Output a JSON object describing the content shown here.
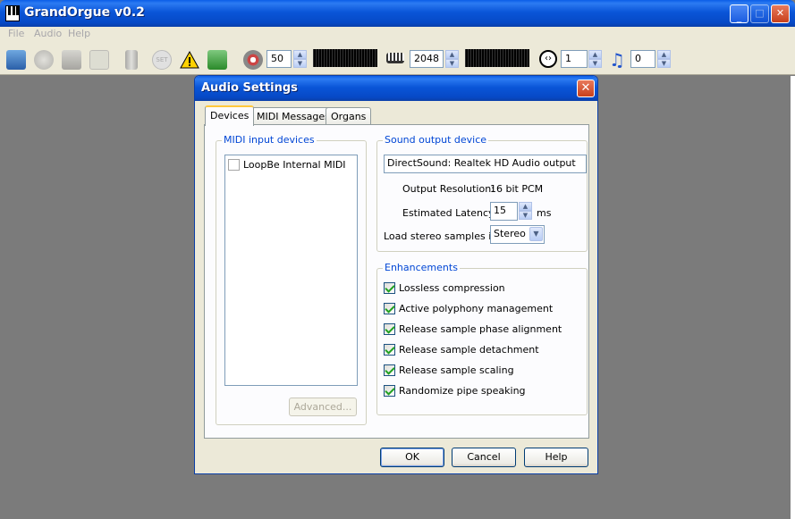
{
  "window": {
    "title": "GrandOrgue v0.2"
  },
  "menu": {
    "items": [
      "File",
      "Audio",
      "Help"
    ]
  },
  "toolbar": {
    "volume": "50",
    "polyphony": "2048",
    "transpose": "1",
    "midi_channel": "0"
  },
  "dialog": {
    "title": "Audio Settings",
    "tabs": [
      "Devices",
      "MIDI Messages",
      "Organs"
    ],
    "midi_group_label": "MIDI input devices",
    "midi_devices": [
      {
        "name": "LoopBe Internal MIDI",
        "checked": false
      }
    ],
    "advanced_button": "Advanced...",
    "sound_group_label": "Sound output device",
    "sound_device": "DirectSound: Realtek HD Audio output",
    "output_resolution_label": "Output Resolution:",
    "output_resolution_value": "16 bit PCM",
    "latency_label": "Estimated Latency:",
    "latency_value": "15",
    "latency_unit": "ms",
    "stereo_label": "Load stereo samples in:",
    "stereo_value": "Stereo",
    "enhancements_label": "Enhancements",
    "enhancements": [
      {
        "label": "Lossless compression",
        "checked": true
      },
      {
        "label": "Active polyphony management",
        "checked": true
      },
      {
        "label": "Release sample phase alignment",
        "checked": true
      },
      {
        "label": "Release sample detachment",
        "checked": true
      },
      {
        "label": "Release sample scaling",
        "checked": true
      },
      {
        "label": "Randomize pipe speaking",
        "checked": true
      }
    ],
    "ok": "OK",
    "cancel": "Cancel",
    "help": "Help"
  }
}
